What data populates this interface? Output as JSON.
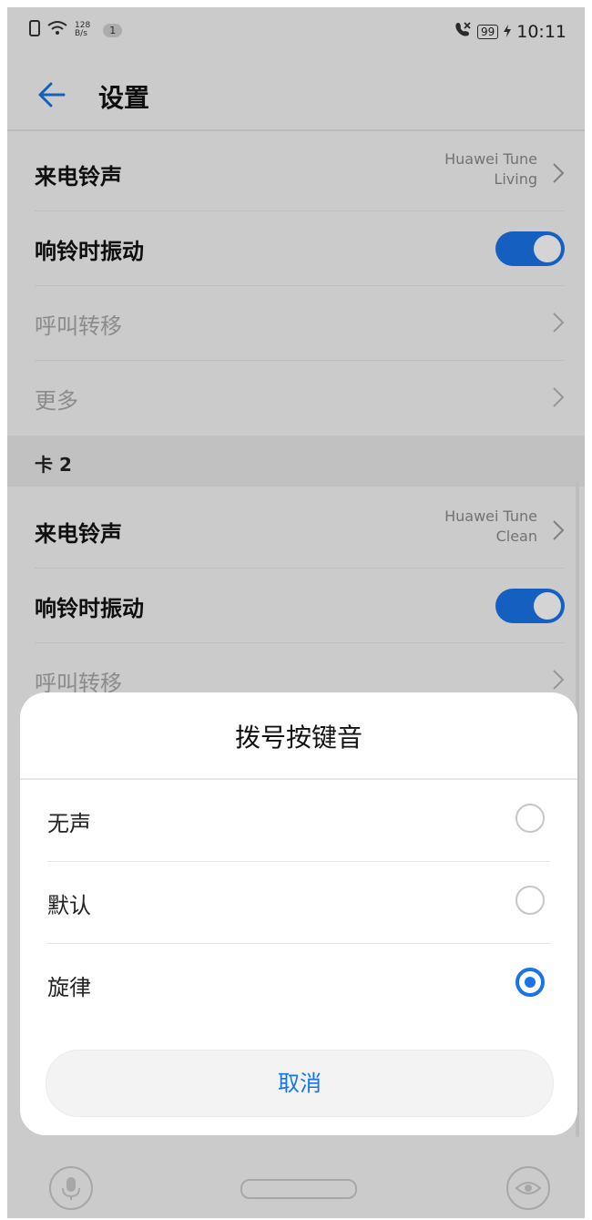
{
  "status_bar": {
    "network_top": "128",
    "network_bottom": "B/s",
    "notification_count": "1",
    "battery": "99",
    "time": "10:11"
  },
  "header": {
    "title": "设置"
  },
  "card1": {
    "ringtone_label": "来电铃声",
    "ringtone_value_line1": "Huawei Tune",
    "ringtone_value_line2": "Living",
    "vibrate_label": "响铃时振动",
    "vibrate_on": true,
    "forward_label": "呼叫转移",
    "more_label": "更多"
  },
  "card2": {
    "section_label": "卡 2",
    "ringtone_label": "来电铃声",
    "ringtone_value_line1": "Huawei Tune",
    "ringtone_value_line2": "Clean",
    "vibrate_label": "响铃时振动",
    "vibrate_on": true,
    "forward_label": "呼叫转移"
  },
  "dialog": {
    "title": "拨号按键音",
    "options": [
      {
        "label": "无声",
        "selected": false
      },
      {
        "label": "默认",
        "selected": false
      },
      {
        "label": "旋律",
        "selected": true
      }
    ],
    "cancel_label": "取消"
  },
  "colors": {
    "accent": "#1a73e8",
    "disabled_text": "#a8a8a8"
  },
  "icons": [
    "back-arrow-icon",
    "wifi-icon",
    "mute-icon",
    "battery-icon",
    "chevron-right-icon",
    "mic-icon",
    "eye-icon"
  ]
}
